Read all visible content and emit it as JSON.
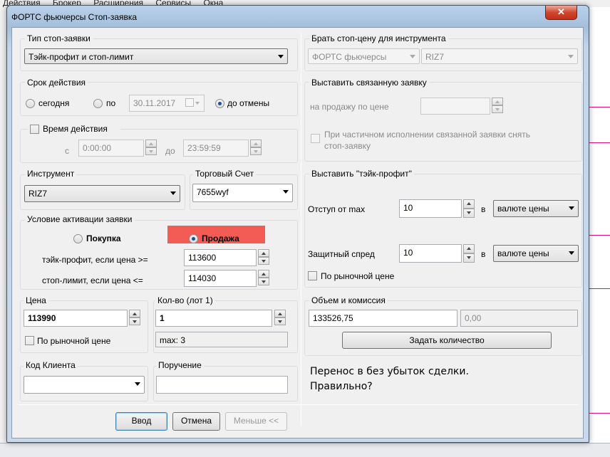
{
  "background": {
    "menu": [
      "Действия",
      "Брокер",
      "Расширения",
      "Сервисы",
      "Окна"
    ]
  },
  "window": {
    "title": "ФОРТС фьючерсы Стоп-заявка",
    "close_symbol": "✕"
  },
  "stop_type": {
    "label": "Тип стоп-заявки",
    "value": "Тэйк-профит и стоп-лимит"
  },
  "duration": {
    "label": "Срок действия",
    "today": "сегодня",
    "until": "по",
    "date": "30.11.2017",
    "until_cancel": "до отмены",
    "selected": "до отмены"
  },
  "action_time": {
    "label": "Время действия",
    "from_label": "с",
    "from": "0:00:00",
    "to_label": "до",
    "to": "23:59:59"
  },
  "instrument": {
    "label": "Инструмент",
    "value": "RIZ7"
  },
  "account": {
    "label": "Торговый Счет",
    "value": "7655wyf"
  },
  "activation": {
    "label": "Условие активации заявки",
    "buy": "Покупка",
    "sell": "Продажа",
    "selected": "Продажа",
    "take_profit_label": "тэйк-профит, если цена >=",
    "take_profit_value": "113600",
    "stop_limit_label": "стоп-лимит, если цена <=",
    "stop_limit_value": "114030",
    "sell_color": "#f25c54"
  },
  "price": {
    "label": "Цена",
    "value": "113990",
    "market_label": "По рыночной цене"
  },
  "quantity": {
    "label": "Кол-во (лот 1)",
    "value": "1",
    "max": "max: 3"
  },
  "client_code": {
    "label": "Код Клиента",
    "value": ""
  },
  "instruction": {
    "label": "Поручение",
    "value": ""
  },
  "stop_price_source": {
    "label": "Брать стоп-цену для инструмента",
    "class": "ФОРТС фьючерсы",
    "instrument": "RIZ7"
  },
  "linked_order": {
    "label": "Выставить связанную заявку",
    "sell_at_price": "на продажу по цене",
    "partial_label_1": "При частичном исполнении связанной заявки снять",
    "partial_label_2": "стоп-заявку"
  },
  "take_profit": {
    "label": "Выставить \"тэйк-профит\"",
    "offset_label": "Отступ от max",
    "offset_value": "10",
    "in_label": "в",
    "offset_unit": "валюте цены",
    "spread_label": "Защитный спред",
    "spread_value": "10",
    "spread_unit": "валюте цены",
    "market_label": "По рыночной цене"
  },
  "volume": {
    "label": "Объем и комиссия",
    "amount": "133526,75",
    "commission": "0,00",
    "set_qty_button": "Задать количество"
  },
  "note": {
    "line1": "Перенос в без убыток сделки.",
    "line2": "Правильно?"
  },
  "buttons": {
    "enter": "Ввод",
    "cancel": "Отмена",
    "less": "Меньше <<"
  }
}
